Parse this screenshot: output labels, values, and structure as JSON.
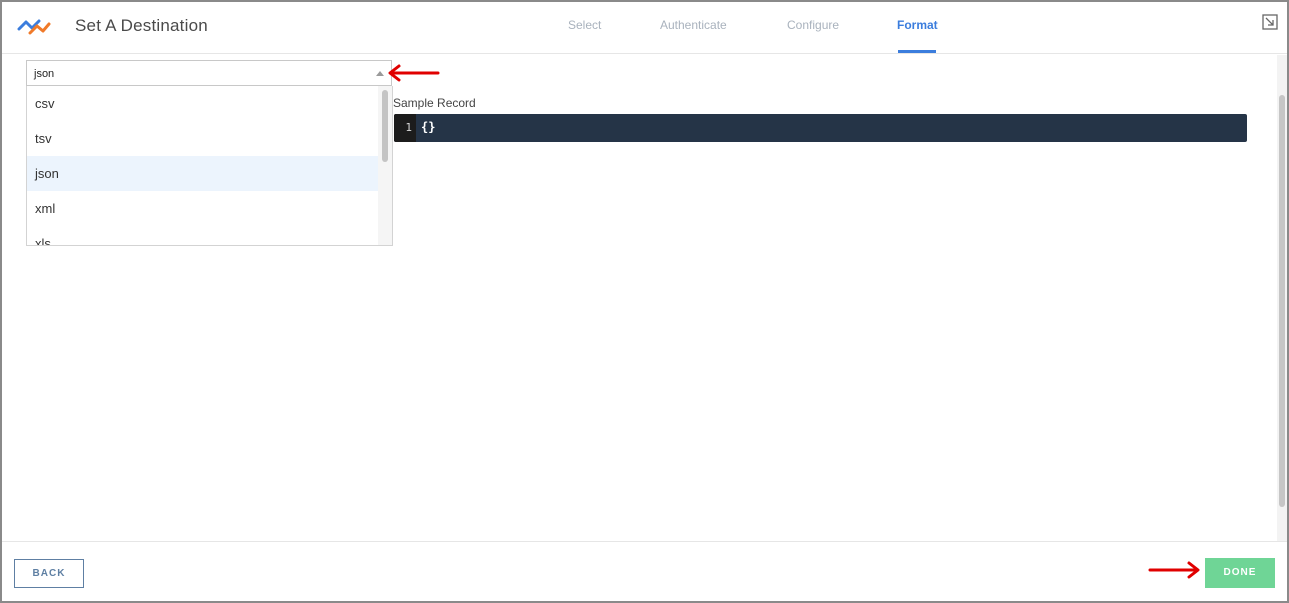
{
  "header": {
    "title": "Set A Destination",
    "steps": [
      {
        "label": "Select",
        "active": false
      },
      {
        "label": "Authenticate",
        "active": false
      },
      {
        "label": "Configure",
        "active": false
      },
      {
        "label": "Format",
        "active": true
      }
    ],
    "icons": {
      "logo": "brand-logo-icon",
      "expand": "expand-icon"
    }
  },
  "format_select": {
    "value": "json",
    "options": [
      "csv",
      "tsv",
      "json",
      "xml",
      "xls"
    ],
    "selected_index": 2
  },
  "sample_record": {
    "label": "Sample Record",
    "line_number": "1",
    "code": "{}"
  },
  "footer": {
    "back_label": "BACK",
    "done_label": "DONE"
  },
  "colors": {
    "accent": "#3b7ddd",
    "done": "#6fd596",
    "back_border": "#5e7fa3",
    "code_bg": "#253447",
    "annotation_arrow": "#e00000"
  }
}
